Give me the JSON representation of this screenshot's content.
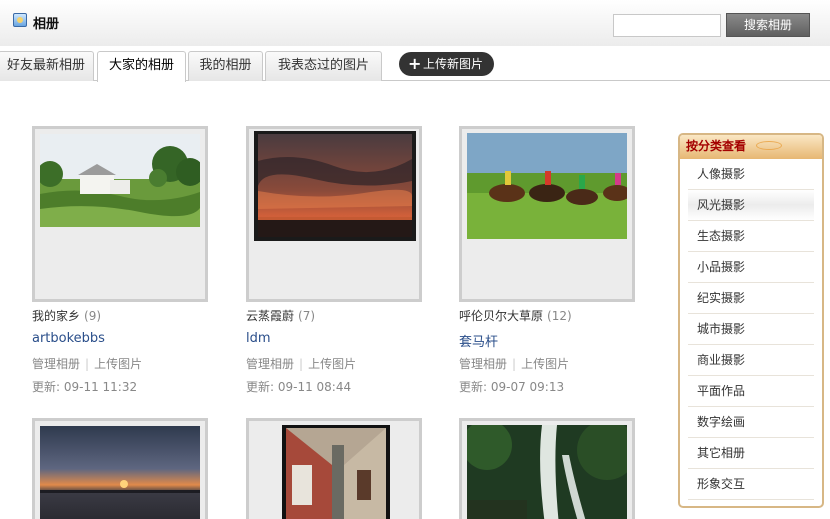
{
  "header": {
    "title": "相册",
    "search_placeholder": "",
    "search_button": "搜索相册"
  },
  "tabs": [
    {
      "label": "好友最新相册"
    },
    {
      "label": "大家的相册"
    },
    {
      "label": "我的相册"
    },
    {
      "label": "我表态过的图片"
    }
  ],
  "upload_button": "上传新图片",
  "albums": [
    {
      "name": "我的家乡",
      "count": "(9)",
      "owner": "artbokebbs",
      "manage": "管理相册",
      "upload": "上传图片",
      "updated": "更新: 09-11 11:32"
    },
    {
      "name": "云蒸霞蔚",
      "count": "(7)",
      "owner": "ldm",
      "manage": "管理相册",
      "upload": "上传图片",
      "updated": "更新: 09-11 08:44"
    },
    {
      "name": "呼伦贝尔大草原",
      "count": "(12)",
      "owner": "套马杆",
      "manage": "管理相册",
      "upload": "上传图片",
      "updated": "更新: 09-07 09:13"
    }
  ],
  "categories": {
    "title": "按分类查看",
    "items": [
      "人像摄影",
      "风光摄影",
      "生态摄影",
      "小品摄影",
      "纪实摄影",
      "城市摄影",
      "商业摄影",
      "平面作品",
      "数字绘画",
      "其它相册",
      "形象交互"
    ]
  },
  "colors": {
    "accent_dark": "#333333",
    "link_blue": "#2a4e8a",
    "category_title": "#a40000",
    "category_border": "#d7b785"
  }
}
